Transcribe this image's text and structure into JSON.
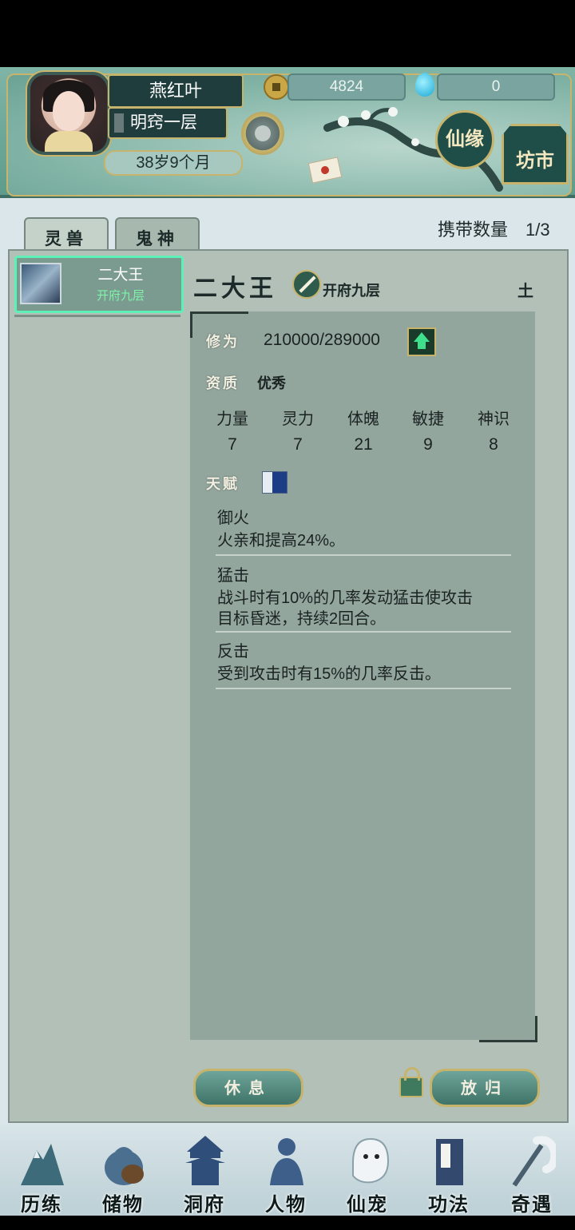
{
  "player": {
    "name": "燕红叶",
    "realm": "明窍一层",
    "age": "38岁9个月"
  },
  "currency": {
    "coins": "4824",
    "spirit_drops": "0"
  },
  "header_buttons": {
    "xianyuan": "仙缘",
    "fangshi": "坊市"
  },
  "tabs": [
    {
      "label": "灵兽",
      "active": true
    },
    {
      "label": "鬼神",
      "active": false
    }
  ],
  "carry": {
    "label": "携带数量",
    "count": "1/3"
  },
  "pet_list": [
    {
      "name": "二大王",
      "realm": "开府九层",
      "selected": true
    }
  ],
  "pet_detail": {
    "name": "二大王",
    "realm": "开府九层",
    "element": "土",
    "cultivation_label": "修为",
    "cultivation_value": "210000/289000",
    "aptitude_label": "资质",
    "aptitude_value": "优秀",
    "attributes": [
      {
        "label": "力量",
        "value": "7"
      },
      {
        "label": "灵力",
        "value": "7"
      },
      {
        "label": "体魄",
        "value": "21"
      },
      {
        "label": "敏捷",
        "value": "9"
      },
      {
        "label": "神识",
        "value": "8"
      }
    ],
    "talent_label": "天赋",
    "talents": [
      {
        "name": "御火",
        "desc": "火亲和提高24%。"
      },
      {
        "name": "猛击",
        "desc": "战斗时有10%的几率发动猛击使攻击目标昏迷，持续2回合。"
      },
      {
        "name": "反击",
        "desc": "受到攻击时有15%的几率反击。"
      }
    ]
  },
  "actions": {
    "rest": "休息",
    "release": "放归"
  },
  "nav": [
    {
      "label": "历练",
      "icon": "mountain-icon"
    },
    {
      "label": "储物",
      "icon": "pouch-icon"
    },
    {
      "label": "洞府",
      "icon": "pagoda-icon"
    },
    {
      "label": "人物",
      "icon": "person-icon"
    },
    {
      "label": "仙宠",
      "icon": "ghost-pet-icon"
    },
    {
      "label": "功法",
      "icon": "scroll-book-icon"
    },
    {
      "label": "奇遇",
      "icon": "hook-icon"
    }
  ],
  "colors": {
    "selected_border": "#5ff0b8",
    "pet_realm": "#7ff3a8",
    "gold_trim": "#c6b36c"
  }
}
